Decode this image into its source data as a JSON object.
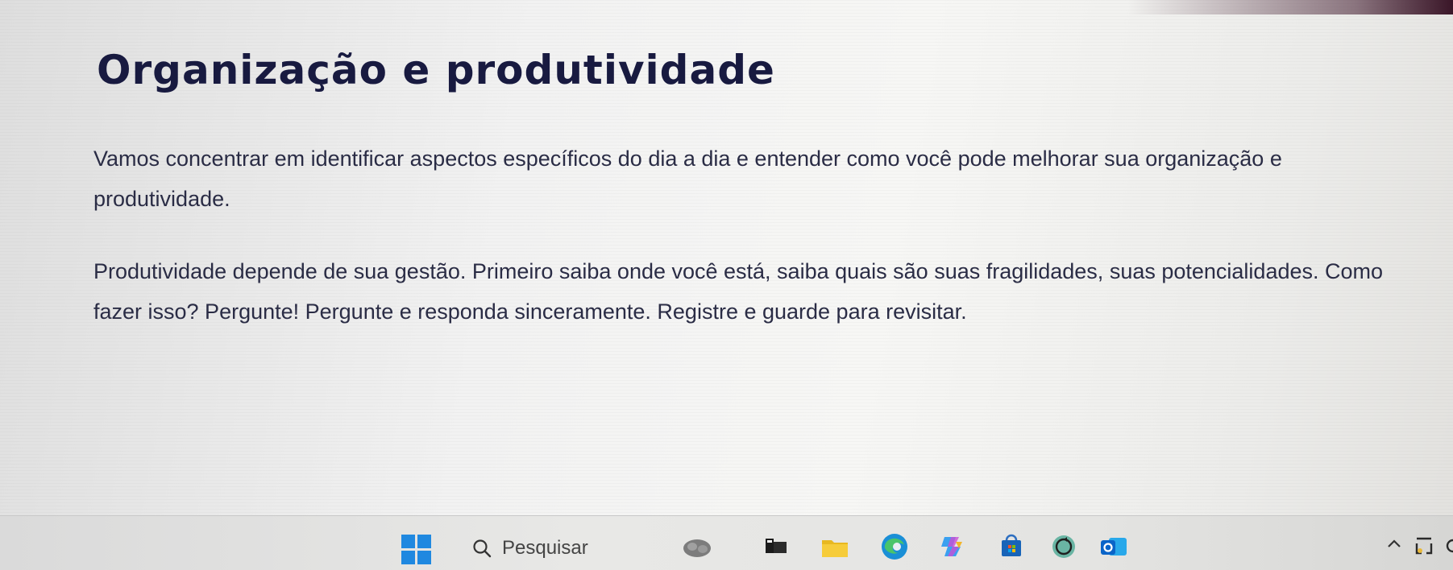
{
  "content": {
    "title": "Organização e produtividade",
    "paragraph_1": "Vamos concentrar em identificar aspectos específicos do dia a dia e entender como você pode melhorar sua organização e produtividade.",
    "paragraph_2": "Produtividade depende de sua gestão. Primeiro saiba onde você está, saiba quais são suas fragilidades, suas potencialidades. Como fazer isso? Pergunte! Pergunte e responda sinceramente. Registre e guarde para revisitar."
  },
  "taskbar": {
    "search_label": "Pesquisar",
    "apps": [
      {
        "icon": "widget-icon"
      },
      {
        "icon": "task-view-icon"
      },
      {
        "icon": "file-explorer-icon"
      },
      {
        "icon": "edge-icon"
      },
      {
        "icon": "copilot-icon"
      },
      {
        "icon": "microsoft-store-icon"
      },
      {
        "icon": "sync-app-icon"
      },
      {
        "icon": "outlook-icon"
      }
    ],
    "tray": [
      {
        "icon": "chevron-up-icon"
      },
      {
        "icon": "app-tray-icon"
      }
    ]
  },
  "colors": {
    "title_text": "#181a40",
    "body_text": "#2a2c45",
    "start_blue": "#1f88e0",
    "background": "#f2f2f2"
  }
}
